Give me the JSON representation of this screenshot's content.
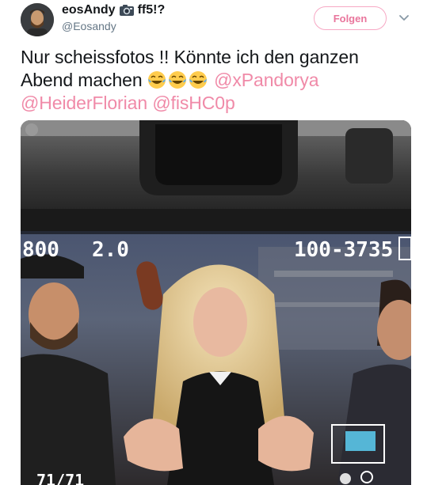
{
  "tweet": {
    "author": {
      "display_name": "eosAndy",
      "name_suffix": "ff5!?",
      "handle": "@Eosandy"
    },
    "follow_label": "Folgen",
    "text_line1": "Nur scheissfotos !! Könnte ich den ganzen",
    "text_line2": "Abend machen",
    "mentions": [
      "@xPandorya",
      "@HeiderFlorian",
      "@fisHC0p"
    ],
    "emoji_count": 3,
    "photo": {
      "hud_iso": "800",
      "hud_aperture": "2.0",
      "hud_range": "100-3735",
      "hud_counter": "71/71"
    }
  },
  "colors": {
    "accent": "#e9759c",
    "mention": "#f08aa8",
    "text": "#14171a",
    "secondary": "#657786"
  },
  "icons": [
    "camera-emoji-icon",
    "chevron-down-icon",
    "laughing-emoji-icon"
  ]
}
